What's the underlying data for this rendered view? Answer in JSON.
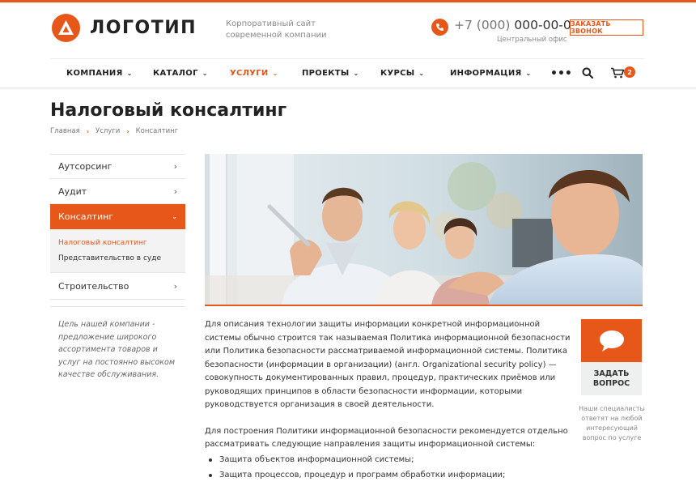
{
  "brand": {
    "logo_text": "ЛОГОТИП",
    "accent": "#e8571a"
  },
  "header": {
    "tagline_line1": "Корпоративный сайт",
    "tagline_line2": "современной компании",
    "phone_prefix": "+7 (000)",
    "phone_number": "000-00-00",
    "phone_caption": "Центральный офис",
    "callback_label": "ЗАКАЗАТЬ ЗВОНОК"
  },
  "nav": {
    "items": [
      {
        "label": "КОМПАНИЯ"
      },
      {
        "label": "КАТАЛОГ"
      },
      {
        "label": "УСЛУГИ"
      },
      {
        "label": "ПРОЕКТЫ"
      },
      {
        "label": "КУРСЫ"
      },
      {
        "label": "ИНФОРМАЦИЯ"
      }
    ],
    "more_label": "•••",
    "cart_count": "2"
  },
  "page": {
    "title": "Налоговый консалтинг",
    "breadcrumb": [
      "Главная",
      "Услуги",
      "Консалтинг"
    ]
  },
  "sidebar": {
    "items": [
      {
        "label": "Аутсорсинг"
      },
      {
        "label": "Аудит"
      },
      {
        "label": "Консалтинг"
      },
      {
        "label": "Строительство"
      }
    ],
    "subitems": [
      {
        "label": "Налоговый консалтинг"
      },
      {
        "label": "Представительство в суде"
      }
    ],
    "note": "Цель нашей компании - предложение широкого ассортимента товаров и услуг на постоянно высоком качестве обслуживания."
  },
  "content": {
    "paragraph1": "Для описания технологии защиты информации конкретной информационной системы обычно строится так называемая Политика информационной безопасности или Политика безопасности рассматриваемой информационной системы. Политика безопасности (информации в организации) (англ. Organizational security policy) — совокупность документированных правил, процедур, практических приёмов или руководящих принципов в области безопасности информации, которыми руководствуется организация в своей деятельности.",
    "paragraph2": "Для построения Политики информационной безопасности рекомендуется отдельно рассматривать следующие направления защиты информационной системы:",
    "bullets": [
      "Защита объектов информационной системы;",
      "Защита процессов, процедур и программ обработки информации;"
    ]
  },
  "ask": {
    "line1": "ЗАДАТЬ",
    "line2": "ВОПРОС",
    "caption": "Наши специалисты ответят на любой интересующий вопрос по услуге"
  }
}
